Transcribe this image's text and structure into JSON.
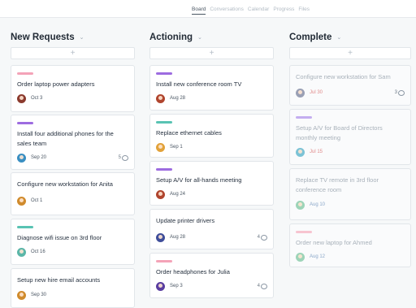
{
  "tabs": [
    "Board",
    "Conversations",
    "Calendar",
    "Progress",
    "Files"
  ],
  "columns": [
    {
      "title": "New Requests",
      "add": "+",
      "cards": [
        {
          "tag": "#f4a3b8",
          "title": "Order laptop power adapters",
          "avatar": "#8b3a2e",
          "date": "Oct 3",
          "comments": ""
        },
        {
          "tag": "#9d6ce0",
          "title": "Install four additional phones for the sales team",
          "avatar": "#3a8fc2",
          "date": "Sep 20",
          "comments": "5"
        },
        {
          "tag": "",
          "title": "Configure new workstation for Anita",
          "avatar": "#d08b2d",
          "date": "Oct 1",
          "comments": ""
        },
        {
          "tag": "#59c3b3",
          "title": "Diagnose wifi issue on 3rd floor",
          "avatar": "#5bb6a8",
          "date": "Oct 16",
          "comments": ""
        },
        {
          "tag": "",
          "title": "Setup new hire email accounts",
          "avatar": "#d08b2d",
          "date": "Sep 30",
          "comments": ""
        }
      ]
    },
    {
      "title": "Actioning",
      "add": "+",
      "cards": [
        {
          "tag": "#9d6ce0",
          "title": "Install new conference room TV",
          "avatar": "#b0452e",
          "date": "Aug 28",
          "comments": ""
        },
        {
          "tag": "#59c3b3",
          "title": "Replace ethernet cables",
          "avatar": "#e2a23a",
          "date": "Sep 1",
          "comments": ""
        },
        {
          "tag": "#9d6ce0",
          "title": "Setup A/V for all-hands meeting",
          "avatar": "#b0452e",
          "date": "Aug 24",
          "comments": ""
        },
        {
          "tag": "",
          "title": "Update printer drivers",
          "avatar": "#3f4e9a",
          "date": "Aug 28",
          "comments": "4"
        },
        {
          "tag": "#f4a3b8",
          "title": "Order headphones for Julia",
          "avatar": "#5a3ea0",
          "date": "Sep 3",
          "comments": "4"
        }
      ]
    },
    {
      "title": "Complete",
      "add": "+",
      "cards": [
        {
          "tag": "",
          "title": "Configure new workstation for Sam",
          "avatar": "#9aa0b5",
          "date": "Jul 30",
          "comments": "3"
        },
        {
          "tag": "#c4aef0",
          "title": "Setup A/V for Board of Directors monthly meeting",
          "avatar": "#7cc3d6",
          "date": "Jul 15",
          "comments": ""
        },
        {
          "tag": "",
          "title": "Replace TV remote in 3rd floor conference room",
          "avatar": "#9dd4b8",
          "date": "Aug 10",
          "comments": ""
        },
        {
          "tag": "#f7c4d0",
          "title": "Order new laptop for Ahmed",
          "avatar": "#9dd4b8",
          "date": "Aug 12",
          "comments": ""
        }
      ]
    }
  ]
}
